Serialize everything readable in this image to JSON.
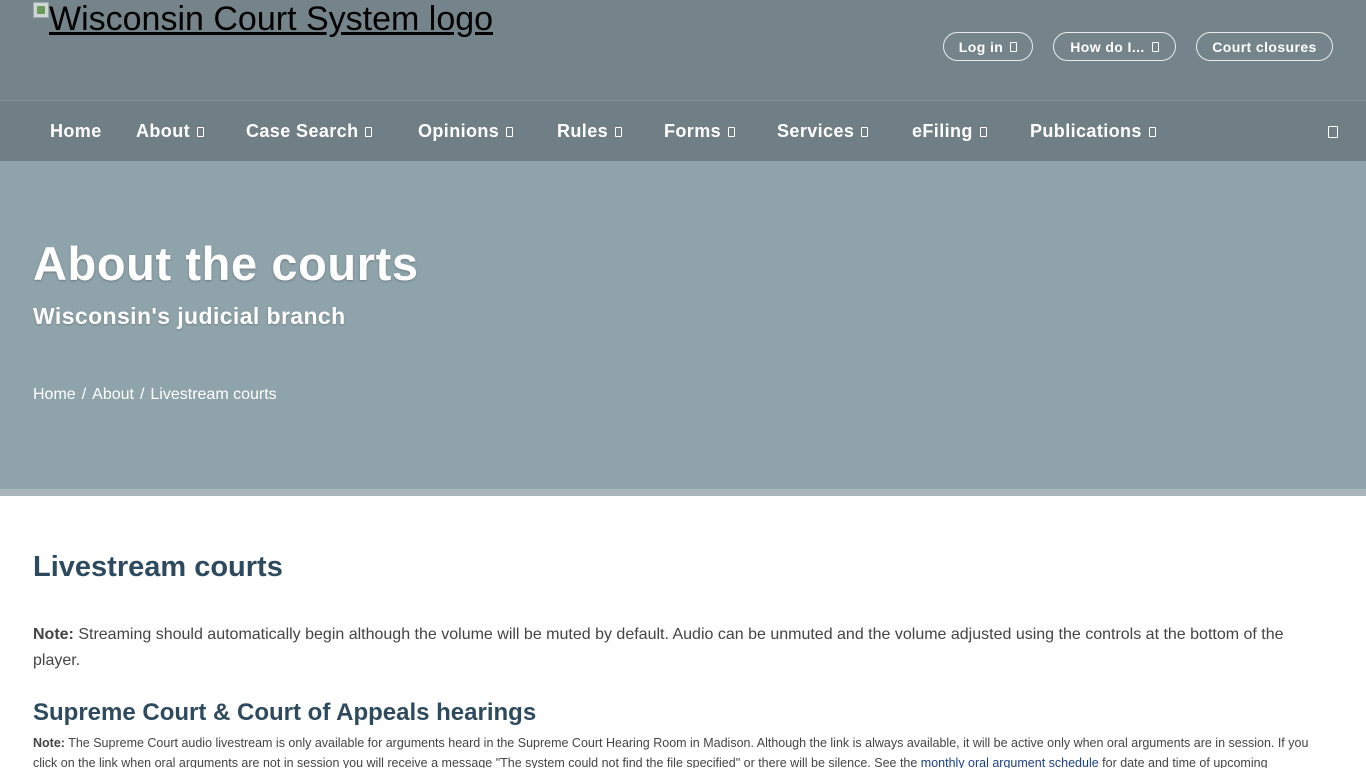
{
  "header": {
    "logo_alt": "Wisconsin Court System logo",
    "login_label": "Log in",
    "howdoi_label": "How do I...",
    "closures_label": "Court closures"
  },
  "nav": {
    "items": [
      {
        "label": "Home",
        "has_menu": false
      },
      {
        "label": "About",
        "has_menu": true
      },
      {
        "label": "Case Search",
        "has_menu": true
      },
      {
        "label": "Opinions",
        "has_menu": true
      },
      {
        "label": "Rules",
        "has_menu": true
      },
      {
        "label": "Forms",
        "has_menu": true
      },
      {
        "label": "Services",
        "has_menu": true
      },
      {
        "label": "eFiling",
        "has_menu": true
      },
      {
        "label": "Publications",
        "has_menu": true
      }
    ]
  },
  "hero": {
    "title": "About the courts",
    "subtitle": "Wisconsin's judicial branch",
    "breadcrumb": [
      "Home",
      "About",
      "Livestream courts"
    ]
  },
  "content": {
    "page_heading": "Livestream courts",
    "note1_label": "Note:",
    "note1_text": " Streaming should automatically begin although the volume will be muted by default. Audio can be unmuted and the volume adjusted using the controls at the bottom of the player.",
    "section_heading": "Supreme Court & Court of Appeals hearings",
    "note2_label": "Note:",
    "note2_text_a": " The Supreme Court audio livestream is only available for arguments heard in the Supreme Court Hearing Room in Madison. Although the link is always available, it will be active only when oral arguments are in session. If you click on the link when oral arguments are not in session you will receive a message \"The system could not find the file specified\" or there will be silence. See the ",
    "note2_link": "monthly oral argument schedule",
    "note2_text_b": " for date and time of upcoming"
  },
  "colors": {
    "header_bg": "#74848a",
    "nav_bg": "#6f7f85",
    "hero_bg": "#8fa3aa",
    "heading": "#2e4a5e",
    "link": "#1c3f82"
  },
  "icons": {
    "dropdown": "chevron-square-icon",
    "search": "search-icon",
    "logo": "broken-image-icon"
  }
}
